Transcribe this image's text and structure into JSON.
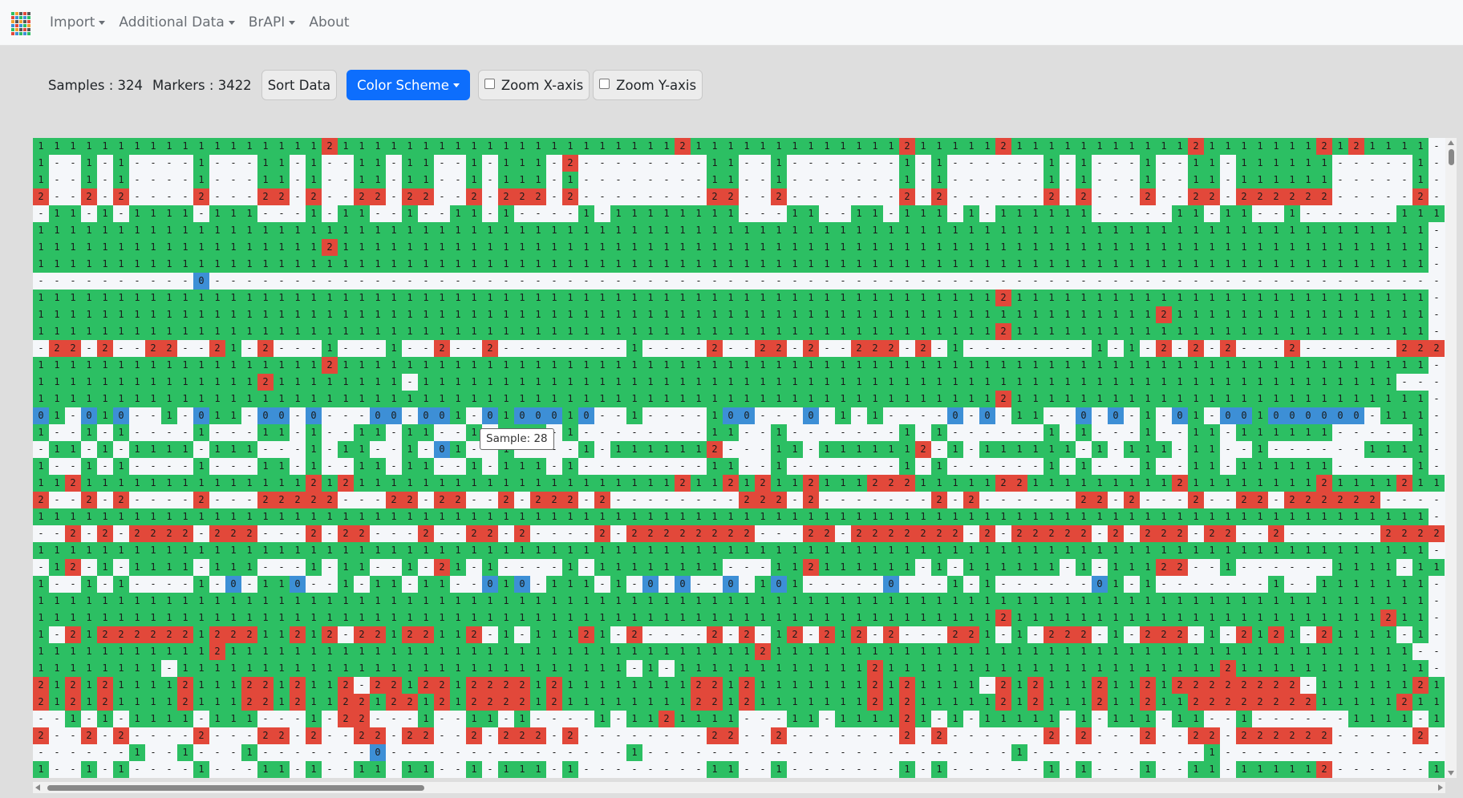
{
  "nav": {
    "items": [
      {
        "label": "Import",
        "dropdown": true
      },
      {
        "label": "Additional Data",
        "dropdown": true
      },
      {
        "label": "BrAPI",
        "dropdown": true
      },
      {
        "label": "About",
        "dropdown": false
      }
    ]
  },
  "toolbar": {
    "samples_text": "Samples : 324",
    "markers_text": "Markers : 3422",
    "sort_label": "Sort Data",
    "color_scheme_label": "Color Scheme",
    "zoom_x_label": "Zoom X-axis",
    "zoom_y_label": "Zoom Y-axis",
    "zoom_x_checked": false,
    "zoom_y_checked": false
  },
  "tooltip": {
    "text": "Sample: 28"
  },
  "colors": {
    "genotype_1": "#2cbf63",
    "genotype_2": "#e2483a",
    "genotype_0": "#3d8fd6",
    "missing": "#f5f7fa",
    "primary": "#0d6efd"
  },
  "grid": {
    "legend": {
      "1": "genotype_1",
      "2": "genotype_2",
      "0": "genotype_0",
      "-": "missing"
    },
    "rows": [
      "111111111111111111211111111111111111111121111111111111211111211111111111211111112121111",
      "1--1-1----1---11-1--11-11--1-111-2--------11--1-------1-1------1-1---1--11-111111-----1--",
      "1--1-1----1---11-1--11-11--1-111-1--------11--1-------1-1------1-1---1--11-111111-----1--",
      "2--2-2----2---22-2--22-22--2-222-2--------22--2-------2-2------2-2---2--22-222222-----2--",
      "-11-1-1111-111---1-11--1--11-1----1-11111111---11--11-111-1-111111-----11-11--1------11111-11",
      "111111111111111111111111111111111111111111111111111111111111111111111111111111111111111",
      "111111111111111111211111111111111111111111111111111111111111111111111111111111111111111",
      "111111111111111111111111111111111111111111111111111111111111111111111111111111111111111",
      "----------0-----------------------------------------------------------------------------",
      "111111111111111111111111111111111111111111111111111111111111211111111111111111111111111",
      "111111111111111111111111111111111111111111111111111111111111111111111121111111111111111",
      "111111111111111111111111111111111111111111111111111111111111211111111111111111111111111",
      "-22-2--22--21-2---1---1--2--2--------1----2--22-2--222-2-1--------1-1-2-2-2---2------2222--22",
      "111111111111111111211111111111111111111111111111111111111111111111111111111111111111111",
      "11111111111111211111111-1111111111111111111111111111111111111111111111111111111111111",
      "111111111111111111111111111111111111111111111111111111111111211111111111111111111111111",
      "01-010--1-011-00-0---00-001-0100010--1----100---0-1-1----0-0-11--0-0-1-01-001000000-111-0-",
      "1--1-1----1---11-1--11-11--1-111-1--------11--1-------1-1------1-1---1--11-111111-----1--",
      "-11-1-1111-111---1-11--1-01--1----1-1111112---11-1111112-1-111111-1-111-11--1------1111-21",
      "1--1-1----1---11-1--11-11--1-111-1--------11--1-------1-1------1-1---1--11-111111-----1--",
      "1121111111111111121211111111111111111111211212112111222111112211111111121111111121111211",
      "2--2-2----2---22222---22-22--2-222-2--------222-2-------2-2------22-2---2--22-222222-----2--",
      "111111111111111111111111111111111111111111111111111111111111111111111111111111111111111",
      "--2-2-2222-222---2-22---2--22-2----2-22222222---22-2222222-2-22222-2-222-22--2------2222-22",
      "111111111111111111111111111111111111111111111111111111111111111111111111111111111111111",
      "-12-1-1111-111---1-11--1-21-1----1-11111111---112111111-1-111111-1-11122--1------1111-11",
      "1--1-1----1-0-110--1-11-11--010-111-1-0-0--0-101-----0---1-1------01-1-------1--1111111--0-01-",
      "111111111111111111111111111111111111111111111111111111111111111111111111111111111111111",
      "111111111111111111111111111111111111111111111111111111111111211111111111111111111111211",
      "1-21222222122211212-22122112-1-11121-2----2-2-12-212-2---221-1-222-1-222-1-2121-21111-1-222-2-",
      "11111111111211111111111111111111111111111111121111111111111111111111111111111111111111",
      "11111111-1111111111111111111111111111-1-11111111111121111111111111111111112111111111111",
      "21212111121112212112-22122122221211111111221211111112121111-2121112112122222222-11111121-",
      "21212111121112212112212212122221211111111221211111112121111121211121121122222222111112111",
      "--1-1-1111-111---1-22---1--11-1----1-1121111---11-111121-1-11111-1-111-11--1------1111-11",
      "2--2-2----2---22-2--22-22--2-222-2--------22--2-------2-2------2-2---2--22-222222-----2--",
      "------1--1---1-------0---------------1-----------------------1-----------1--------------",
      "1--1-1----1---11-1--11-11--1-111-1--------11--1-------1-1------1-1---1--11-111112------1--"
    ]
  }
}
